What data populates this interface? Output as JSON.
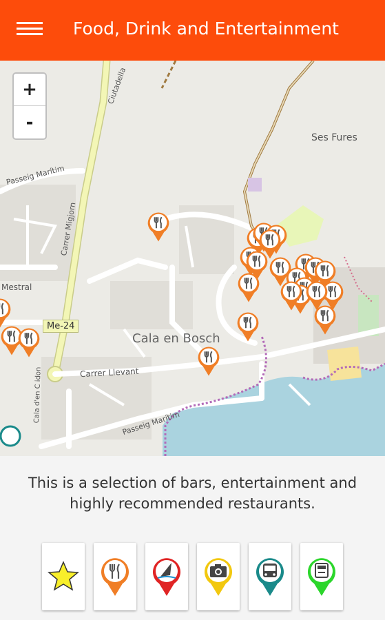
{
  "appbar": {
    "title": "Food, Drink and Entertainment",
    "menu_icon": "hamburger-menu-icon"
  },
  "map": {
    "zoom_in_label": "+",
    "zoom_out_label": "-",
    "labels": {
      "ses_fures": "Ses Fures",
      "cala_en_bosch": "Cala en Bosch",
      "road_me24": "Me-24",
      "passeig_maritim_top": "Passeig Marítim",
      "passeig_maritim_bottom": "Passeig Marítim",
      "carrer_llevant": "Carrer Llevant",
      "carrer_migjorn": "Carrer Migjorn",
      "mestral": "Mestral",
      "ciutadella": "Ciutadella",
      "cala_dun_cidon": "Cala d'en C idon"
    },
    "marker_icon": "restaurant-marker-icon",
    "colors": {
      "marker": "#f07e26",
      "sea": "#aad3df",
      "road": "#ffffff",
      "major_road": "#f5f8b0"
    }
  },
  "description": {
    "line1": "This is a selection of bars, entertainment and",
    "line2": "highly recommended restaurants."
  },
  "categories": [
    {
      "name": "favourites",
      "icon": "star-icon",
      "color": "#f8ef2a"
    },
    {
      "name": "food-drink",
      "icon": "fork-knife-icon",
      "color": "#f07e26"
    },
    {
      "name": "activities",
      "icon": "windsurf-icon",
      "color": "#e02424"
    },
    {
      "name": "sightseeing",
      "icon": "camera-icon",
      "color": "#f2c80f"
    },
    {
      "name": "transport",
      "icon": "bus-icon",
      "color": "#1a8a8a"
    },
    {
      "name": "atm",
      "icon": "atm-icon",
      "color": "#2bd62b"
    }
  ]
}
